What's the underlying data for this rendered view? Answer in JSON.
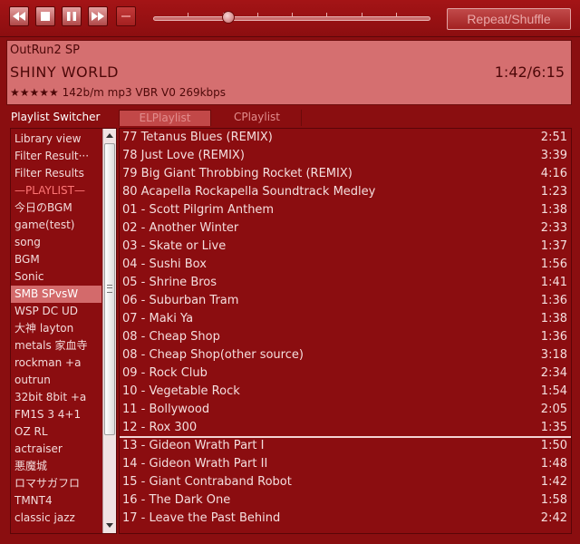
{
  "toolbar": {
    "buttons": [
      "rewind-icon",
      "stop-icon",
      "pause-icon",
      "fast-forward-icon",
      "record-icon"
    ],
    "seek_progress": 0.27,
    "repeat_label": "Repeat/Shuffle"
  },
  "now_playing": {
    "artist": "OutRun2 SP",
    "title": "SHINY WORLD",
    "time": "1:42/6:15",
    "stars": "★★★★★",
    "rating": 5,
    "info": " 142b/m mp3 VBR V0 269kbps"
  },
  "tabs": {
    "switcher_label": "Playlist Switcher",
    "items": [
      "ELPlaylist",
      "CPlaylist"
    ]
  },
  "sidebar": {
    "items": [
      "Library view",
      "Filter Result···",
      "Filter Results",
      "—PLAYLIST—",
      "今日のBGM",
      "game(test)",
      "song",
      "BGM",
      "Sonic",
      "SMB SPvsW",
      "WSP DC UD",
      "大神 layton",
      "metals 家血寺",
      "rockman +a",
      "outrun",
      "32bit 8bit +a",
      "FM1S 3 4+1",
      "OZ RL",
      "actraiser",
      "悪魔城",
      "ロマサガフロ",
      "TMNT4",
      "classic jazz"
    ],
    "active_index": 9,
    "separator_index": 3
  },
  "playlist": {
    "tracks": [
      {
        "title": "77 Tetanus Blues (REMIX)",
        "duration": "2:51"
      },
      {
        "title": "78 Just Love (REMIX)",
        "duration": "3:39"
      },
      {
        "title": "79 Big Giant Throbbing Rocket (REMIX)",
        "duration": "4:16"
      },
      {
        "title": "80 Acapella Rockapella Soundtrack Medley",
        "duration": "1:23"
      },
      {
        "title": "01 - Scott Pilgrim Anthem",
        "duration": "1:38"
      },
      {
        "title": "02 - Another Winter",
        "duration": "2:33"
      },
      {
        "title": "03 - Skate or Live",
        "duration": "1:37"
      },
      {
        "title": "04 - Sushi Box",
        "duration": "1:56"
      },
      {
        "title": "05 - Shrine Bros",
        "duration": "1:41"
      },
      {
        "title": "06 - Suburban Tram",
        "duration": "1:36"
      },
      {
        "title": "07 - Maki Ya",
        "duration": "1:38"
      },
      {
        "title": "08 - Cheap Shop",
        "duration": "1:36"
      },
      {
        "title": "08 - Cheap Shop(other source)",
        "duration": "3:18"
      },
      {
        "title": "09 - Rock Club",
        "duration": "2:34"
      },
      {
        "title": "10 - Vegetable Rock",
        "duration": "1:54"
      },
      {
        "title": "11 - Bollywood",
        "duration": "2:05"
      },
      {
        "title": "12 - Rox 300",
        "duration": "1:35"
      },
      {
        "title": "13 - Gideon Wrath Part I",
        "duration": "1:50"
      },
      {
        "title": "14 - Gideon Wrath Part II",
        "duration": "1:48"
      },
      {
        "title": "15 - Giant Contraband Robot",
        "duration": "1:42"
      },
      {
        "title": "16 - The Dark One",
        "duration": "1:58"
      },
      {
        "title": "17 - Leave the Past Behind",
        "duration": "2:42"
      }
    ]
  }
}
